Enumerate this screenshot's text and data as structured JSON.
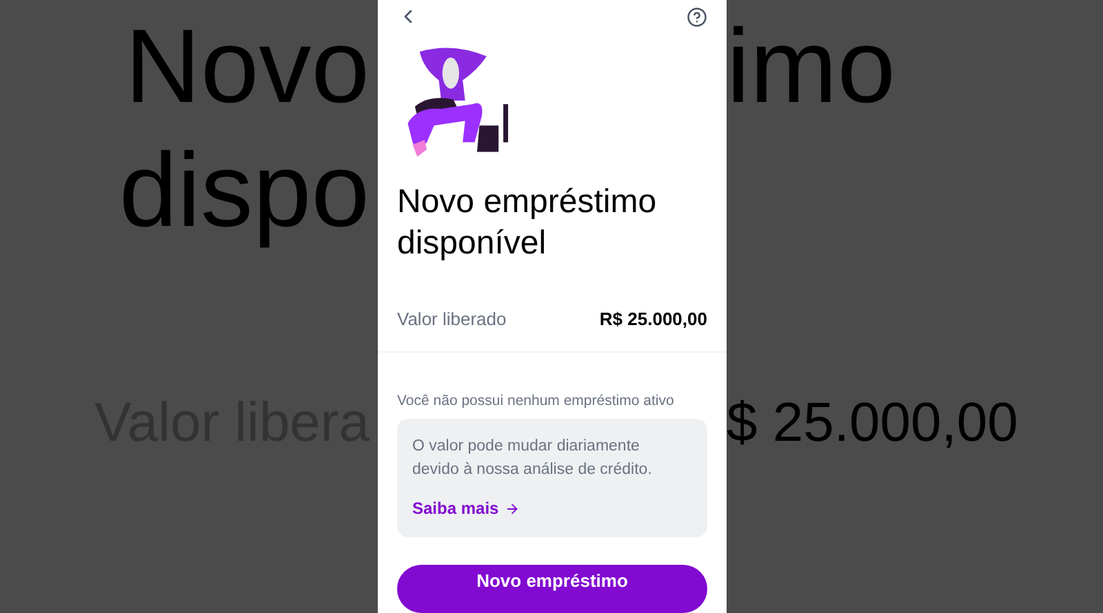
{
  "background": {
    "left_lines": [
      "Novo",
      "dispo",
      "Valor libera"
    ],
    "right_lines": [
      "imo",
      "$ 25.000,00"
    ]
  },
  "title": "Novo empréstimo disponível",
  "amount": {
    "label": "Valor liberado",
    "value": "R$ 25.000,00"
  },
  "status_text": "Você não possui nenhum empréstimo ativo",
  "info_card": {
    "text": "O valor pode mudar diariamente devido à nossa análise de crédito.",
    "link": "Saiba mais"
  },
  "primary_button": "Novo empréstimo"
}
